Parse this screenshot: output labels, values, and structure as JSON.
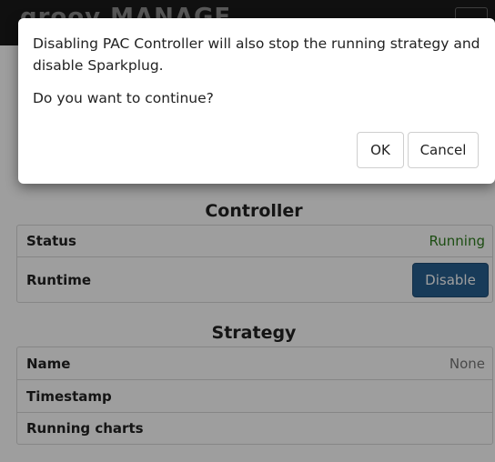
{
  "header": {
    "brand": "groov MANAGE"
  },
  "dialog": {
    "message": "Disabling PAC Controller will also stop the running strategy and disable Sparkplug.",
    "question": "Do you want to continue?",
    "ok_label": "OK",
    "cancel_label": "Cancel"
  },
  "controller": {
    "title": "Controller",
    "rows": [
      {
        "label": "Status",
        "value": "Running"
      },
      {
        "label": "Runtime",
        "button_label": "Disable"
      }
    ]
  },
  "strategy": {
    "title": "Strategy",
    "rows": [
      {
        "label": "Name",
        "value": "None"
      },
      {
        "label": "Timestamp",
        "value": ""
      },
      {
        "label": "Running charts",
        "value": ""
      }
    ]
  },
  "colors": {
    "running_status": "#2e7d1e",
    "primary_button": "#286090",
    "topbar": "#1b1b1b"
  }
}
